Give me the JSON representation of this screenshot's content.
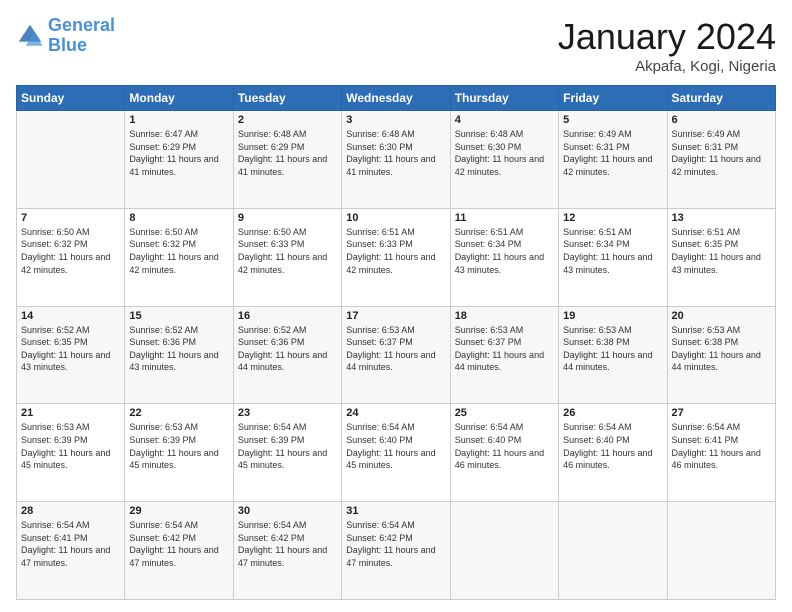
{
  "header": {
    "logo_general": "General",
    "logo_blue": "Blue",
    "month_title": "January 2024",
    "location": "Akpafa, Kogi, Nigeria"
  },
  "columns": [
    "Sunday",
    "Monday",
    "Tuesday",
    "Wednesday",
    "Thursday",
    "Friday",
    "Saturday"
  ],
  "weeks": [
    [
      {
        "day": "",
        "sunrise": "",
        "sunset": "",
        "daylight": ""
      },
      {
        "day": "1",
        "sunrise": "Sunrise: 6:47 AM",
        "sunset": "Sunset: 6:29 PM",
        "daylight": "Daylight: 11 hours and 41 minutes."
      },
      {
        "day": "2",
        "sunrise": "Sunrise: 6:48 AM",
        "sunset": "Sunset: 6:29 PM",
        "daylight": "Daylight: 11 hours and 41 minutes."
      },
      {
        "day": "3",
        "sunrise": "Sunrise: 6:48 AM",
        "sunset": "Sunset: 6:30 PM",
        "daylight": "Daylight: 11 hours and 41 minutes."
      },
      {
        "day": "4",
        "sunrise": "Sunrise: 6:48 AM",
        "sunset": "Sunset: 6:30 PM",
        "daylight": "Daylight: 11 hours and 42 minutes."
      },
      {
        "day": "5",
        "sunrise": "Sunrise: 6:49 AM",
        "sunset": "Sunset: 6:31 PM",
        "daylight": "Daylight: 11 hours and 42 minutes."
      },
      {
        "day": "6",
        "sunrise": "Sunrise: 6:49 AM",
        "sunset": "Sunset: 6:31 PM",
        "daylight": "Daylight: 11 hours and 42 minutes."
      }
    ],
    [
      {
        "day": "7",
        "sunrise": "Sunrise: 6:50 AM",
        "sunset": "Sunset: 6:32 PM",
        "daylight": "Daylight: 11 hours and 42 minutes."
      },
      {
        "day": "8",
        "sunrise": "Sunrise: 6:50 AM",
        "sunset": "Sunset: 6:32 PM",
        "daylight": "Daylight: 11 hours and 42 minutes."
      },
      {
        "day": "9",
        "sunrise": "Sunrise: 6:50 AM",
        "sunset": "Sunset: 6:33 PM",
        "daylight": "Daylight: 11 hours and 42 minutes."
      },
      {
        "day": "10",
        "sunrise": "Sunrise: 6:51 AM",
        "sunset": "Sunset: 6:33 PM",
        "daylight": "Daylight: 11 hours and 42 minutes."
      },
      {
        "day": "11",
        "sunrise": "Sunrise: 6:51 AM",
        "sunset": "Sunset: 6:34 PM",
        "daylight": "Daylight: 11 hours and 43 minutes."
      },
      {
        "day": "12",
        "sunrise": "Sunrise: 6:51 AM",
        "sunset": "Sunset: 6:34 PM",
        "daylight": "Daylight: 11 hours and 43 minutes."
      },
      {
        "day": "13",
        "sunrise": "Sunrise: 6:51 AM",
        "sunset": "Sunset: 6:35 PM",
        "daylight": "Daylight: 11 hours and 43 minutes."
      }
    ],
    [
      {
        "day": "14",
        "sunrise": "Sunrise: 6:52 AM",
        "sunset": "Sunset: 6:35 PM",
        "daylight": "Daylight: 11 hours and 43 minutes."
      },
      {
        "day": "15",
        "sunrise": "Sunrise: 6:52 AM",
        "sunset": "Sunset: 6:36 PM",
        "daylight": "Daylight: 11 hours and 43 minutes."
      },
      {
        "day": "16",
        "sunrise": "Sunrise: 6:52 AM",
        "sunset": "Sunset: 6:36 PM",
        "daylight": "Daylight: 11 hours and 44 minutes."
      },
      {
        "day": "17",
        "sunrise": "Sunrise: 6:53 AM",
        "sunset": "Sunset: 6:37 PM",
        "daylight": "Daylight: 11 hours and 44 minutes."
      },
      {
        "day": "18",
        "sunrise": "Sunrise: 6:53 AM",
        "sunset": "Sunset: 6:37 PM",
        "daylight": "Daylight: 11 hours and 44 minutes."
      },
      {
        "day": "19",
        "sunrise": "Sunrise: 6:53 AM",
        "sunset": "Sunset: 6:38 PM",
        "daylight": "Daylight: 11 hours and 44 minutes."
      },
      {
        "day": "20",
        "sunrise": "Sunrise: 6:53 AM",
        "sunset": "Sunset: 6:38 PM",
        "daylight": "Daylight: 11 hours and 44 minutes."
      }
    ],
    [
      {
        "day": "21",
        "sunrise": "Sunrise: 6:53 AM",
        "sunset": "Sunset: 6:39 PM",
        "daylight": "Daylight: 11 hours and 45 minutes."
      },
      {
        "day": "22",
        "sunrise": "Sunrise: 6:53 AM",
        "sunset": "Sunset: 6:39 PM",
        "daylight": "Daylight: 11 hours and 45 minutes."
      },
      {
        "day": "23",
        "sunrise": "Sunrise: 6:54 AM",
        "sunset": "Sunset: 6:39 PM",
        "daylight": "Daylight: 11 hours and 45 minutes."
      },
      {
        "day": "24",
        "sunrise": "Sunrise: 6:54 AM",
        "sunset": "Sunset: 6:40 PM",
        "daylight": "Daylight: 11 hours and 45 minutes."
      },
      {
        "day": "25",
        "sunrise": "Sunrise: 6:54 AM",
        "sunset": "Sunset: 6:40 PM",
        "daylight": "Daylight: 11 hours and 46 minutes."
      },
      {
        "day": "26",
        "sunrise": "Sunrise: 6:54 AM",
        "sunset": "Sunset: 6:40 PM",
        "daylight": "Daylight: 11 hours and 46 minutes."
      },
      {
        "day": "27",
        "sunrise": "Sunrise: 6:54 AM",
        "sunset": "Sunset: 6:41 PM",
        "daylight": "Daylight: 11 hours and 46 minutes."
      }
    ],
    [
      {
        "day": "28",
        "sunrise": "Sunrise: 6:54 AM",
        "sunset": "Sunset: 6:41 PM",
        "daylight": "Daylight: 11 hours and 47 minutes."
      },
      {
        "day": "29",
        "sunrise": "Sunrise: 6:54 AM",
        "sunset": "Sunset: 6:42 PM",
        "daylight": "Daylight: 11 hours and 47 minutes."
      },
      {
        "day": "30",
        "sunrise": "Sunrise: 6:54 AM",
        "sunset": "Sunset: 6:42 PM",
        "daylight": "Daylight: 11 hours and 47 minutes."
      },
      {
        "day": "31",
        "sunrise": "Sunrise: 6:54 AM",
        "sunset": "Sunset: 6:42 PM",
        "daylight": "Daylight: 11 hours and 47 minutes."
      },
      {
        "day": "",
        "sunrise": "",
        "sunset": "",
        "daylight": ""
      },
      {
        "day": "",
        "sunrise": "",
        "sunset": "",
        "daylight": ""
      },
      {
        "day": "",
        "sunrise": "",
        "sunset": "",
        "daylight": ""
      }
    ]
  ]
}
